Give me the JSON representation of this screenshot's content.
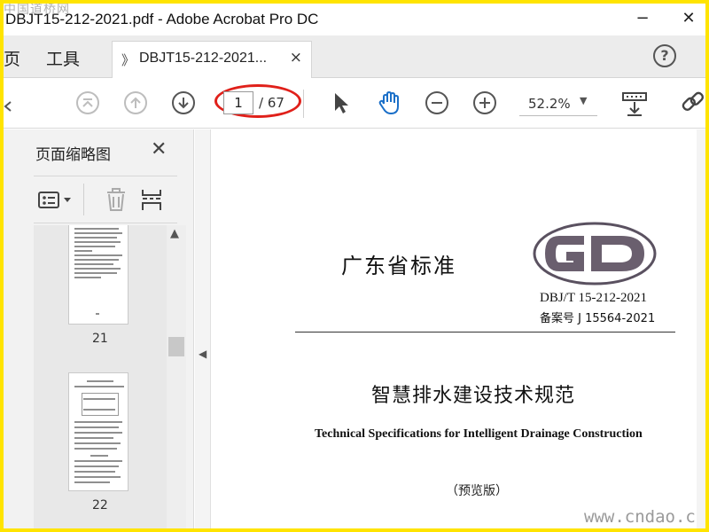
{
  "watermark_top": "中国道桥网",
  "window": {
    "title": "DBJT15-212-2021.pdf - Adobe Acrobat Pro DC",
    "minimize": "−",
    "close": "✕"
  },
  "tabs": {
    "home_fragment": "页",
    "tools": "工具",
    "doc_icon": "》",
    "doc_tab": "DBJT15-212-2021...",
    "doc_close": "×",
    "help": "?"
  },
  "toolbar": {
    "current_page": "1",
    "total_pages": "/ 67",
    "zoom": "52.2%",
    "highlight_color": "#e0201a"
  },
  "panel": {
    "title": "页面缩略图",
    "close": "✕",
    "thumbnails": [
      {
        "page": "21"
      },
      {
        "page": "22"
      }
    ]
  },
  "document": {
    "standard_label": "广东省标准",
    "code": "DBJ/T 15-212-2021",
    "record": "备案号  J 15564-2021",
    "title_cn": "智慧排水建设技术规范",
    "title_en": "Technical Specifications for Intelligent Drainage Construction",
    "edition": "（预览版）"
  },
  "watermark_bottom": "www.cndao.com",
  "icons": [
    "first-page-icon",
    "prev-page-icon",
    "next-page-icon",
    "select-arrow-icon",
    "hand-icon",
    "zoom-out-icon",
    "zoom-in-icon",
    "page-display-icon",
    "link-icon",
    "options-icon",
    "trash-icon",
    "insert-icon"
  ]
}
